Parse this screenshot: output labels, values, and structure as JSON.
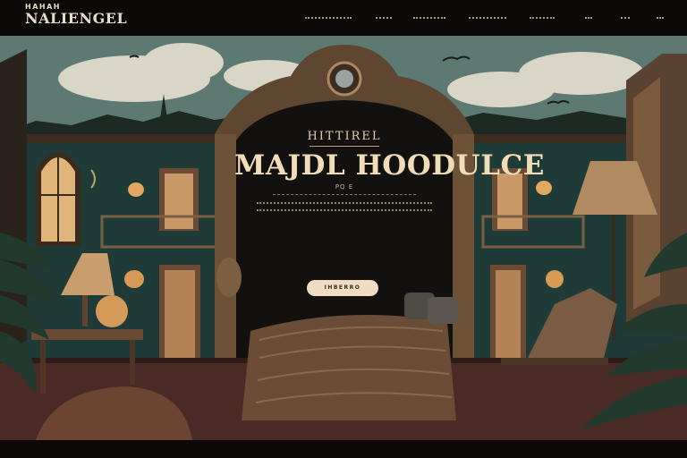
{
  "header": {
    "logo_top": "HAHAH",
    "logo_main": "NALIENGEL",
    "nav": [
      {
        "label": "",
        "icon": "nav-link"
      },
      {
        "label": "",
        "icon": "nav-link"
      },
      {
        "label": "",
        "icon": "nav-link"
      },
      {
        "label": "",
        "icon": "nav-link"
      },
      {
        "label": "",
        "icon": "nav-link"
      },
      {
        "label": "",
        "icon": "nav-link"
      },
      {
        "label": "",
        "icon": "nav-link"
      },
      {
        "label": "",
        "icon": "nav-link"
      }
    ]
  },
  "hero": {
    "eyebrow": "HITTIREL",
    "title": "MAJDL HOODULCE",
    "subtitle": "PQ E",
    "cta_label": "IHBERRO"
  },
  "colors": {
    "sky": "#5e7b72",
    "wall": "#1f3b37",
    "wood": "#6a5139",
    "cream": "#f0dcc2",
    "floor": "#4d2c27"
  }
}
